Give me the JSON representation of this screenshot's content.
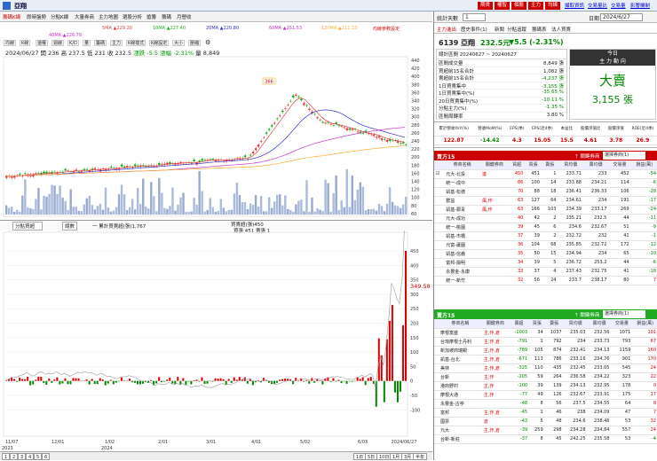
{
  "window": {
    "title": "亞翔",
    "buttons": [
      "期貨",
      "權智",
      "個股",
      "主力",
      "均線"
    ],
    "links": [
      "擷取資訊",
      "交易量比",
      "交易量",
      "影響機制"
    ]
  },
  "top_tabs": [
    "籌碼K線",
    "即時盤勢",
    "分點K線",
    "大量券商",
    "主力地圖",
    "選股分析",
    "搶籌",
    "籌碼",
    "月營收"
  ],
  "ma_legend": [
    {
      "label": "5MA ▲229.20",
      "color": "#d44"
    },
    {
      "label": "10MA ▲227.40",
      "color": "#2a2"
    },
    {
      "label": "20MA ▲220.80",
      "color": "#33c"
    },
    {
      "label": "60MA ▲251.53",
      "color": "#c3c"
    },
    {
      "label": "120MA ▲211.33",
      "color": "#fa3"
    },
    {
      "label": "40MA ▲226.78",
      "color": "#c3c"
    }
  ],
  "right_note": "均線參數設定",
  "chart_toolbar": [
    "均線",
    "K線",
    "還權",
    "週線",
    "K/D",
    "量",
    "籌碼",
    "主力",
    "K線樣式",
    "K線設定",
    "大小",
    "壓縮"
  ],
  "info_line": {
    "date": "2024/06/27",
    "open": "開 236",
    "high": "高 237.5",
    "low": "低 231",
    "close": "收 232.5",
    "change": "漲跌 -5.5",
    "pct": "漲幅 -2.31%",
    "vol": "量 8,849"
  },
  "price_axis": [
    "440",
    "420",
    "400",
    "380",
    "360",
    "340",
    "320",
    "300",
    "280",
    "260",
    "240",
    "220",
    "200",
    "180",
    "160",
    "140",
    "120",
    "100",
    "80",
    "60"
  ],
  "peak_label": "366",
  "lower_header": {
    "select": "分點買超",
    "btn": "總數",
    "legend1": "一 累計買賣超(張)1,767",
    "legend2": "買賣超(張)450",
    "legend3": "買張 451  賣張 1"
  },
  "lower_axis": [
    "450",
    "400",
    "350",
    "300",
    "250",
    "200",
    "150",
    "100",
    "50",
    "0",
    "-50",
    "-100"
  ],
  "lower_label": "349.58",
  "date_axis": [
    "11/07",
    "12/01",
    "1/02",
    "2/01",
    "3/01",
    "4/01",
    "5/02",
    "6/03",
    "2024/06/27"
  ],
  "date_axis_years": [
    "2023",
    "2024"
  ],
  "bottom_pages": [
    "1",
    "2",
    "3",
    "4",
    "5",
    "6"
  ],
  "bottom_periods": [
    "1日",
    "5日",
    "10日",
    "1月",
    "3月",
    "半年"
  ],
  "right": {
    "days_label": "統計天數",
    "days_value": "1",
    "date_label": "日期",
    "date_value": "2024/6/27",
    "tabs": [
      "主力進出",
      "歷史事件(1)",
      "新聞",
      "分點追蹤",
      "籌碼表",
      "法人買賣"
    ],
    "stock": "6139 亞翔",
    "price": "232.5元",
    "chg": "▼5.5 (-2.31%)",
    "summary_title": "總計區間  20240627 ~ 20240627",
    "summary": [
      [
        "區間成交量",
        "8,849 張"
      ],
      [
        "買超前15名合計",
        "1,082 張"
      ],
      [
        "賣超前15名合計",
        "-4,237 張"
      ],
      [
        "1日買賣集中",
        "-3,155 張"
      ],
      [
        "1日買賣集中(%)",
        "-35.65 %"
      ],
      [
        "20日買賣集中(%)",
        "-10.11 %"
      ],
      [
        "分點主力(%)",
        "-1.35 %"
      ],
      [
        "區間周轉率",
        "3.80 %"
      ]
    ],
    "today_label": "今日",
    "today_sub": "主 力 動 向",
    "today_big": "大賣",
    "today_val": "3,155 張",
    "fin_headers": [
      "累計營收YoY(%)",
      "營收MoM(%)",
      "EPS(季)",
      "EPS(近4季)",
      "本益比",
      "股價淨值比",
      "股價淨值",
      "ROE(近4季)"
    ],
    "fin_values": [
      "122.87",
      "-14.42",
      "4.3",
      "15.05",
      "15.5",
      "4.61",
      "3.78",
      "26.9"
    ],
    "buy_title": "買方15",
    "buy_btn": "↑ 關鍵券商",
    "buy_sel": "選擇券商(1)",
    "buy_headers": [
      "",
      "券商名稱",
      "關鍵券商",
      "買超",
      "買張",
      "賣張",
      "買均價",
      "賣均價",
      "交易量",
      "損益(萬)"
    ],
    "buy_rows": [
      [
        "☑",
        "元大-北投",
        "進",
        "450",
        "451",
        "1",
        "233.71",
        "233",
        "452",
        "-54"
      ],
      [
        "",
        "統一-成中",
        "",
        "86",
        "100",
        "14",
        "233.88",
        "234.21",
        "114",
        "-6"
      ],
      [
        "",
        "凱基-松德",
        "",
        "70",
        "88",
        "18",
        "236.41",
        "236.33",
        "106",
        "-28"
      ],
      [
        "",
        "群益",
        "風,作",
        "63",
        "127",
        "64",
        "234.61",
        "234",
        "191",
        "-17"
      ],
      [
        "",
        "凱基-鄭青",
        "風,作",
        "63",
        "166",
        "103",
        "234.39",
        "233.17",
        "269",
        "-24"
      ],
      [
        "",
        "元大-成功",
        "",
        "40",
        "42",
        "2",
        "235.21",
        "232.5",
        "44",
        "-11"
      ],
      [
        "",
        "統一-桃園",
        "",
        "39",
        "45",
        "6",
        "234.6",
        "232.67",
        "51",
        "-9"
      ],
      [
        "",
        "凱基-市橋",
        "",
        "37",
        "39",
        "2",
        "232.72",
        "232",
        "41",
        "-1"
      ],
      [
        "",
        "元富-蘆園",
        "",
        "36",
        "104",
        "68",
        "235.85",
        "232.72",
        "172",
        "-12"
      ],
      [
        "",
        "凱基-信義",
        "",
        "35",
        "50",
        "15",
        "234.94",
        "234",
        "65",
        "-10"
      ],
      [
        "",
        "富邦-陽明",
        "",
        "34",
        "39",
        "5",
        "236.72",
        "253.2",
        "44",
        "-6"
      ],
      [
        "",
        "永豐金-永康",
        "",
        "33",
        "37",
        "4",
        "237.43",
        "232.75",
        "41",
        "-18"
      ],
      [
        "",
        "統一-新竹",
        "",
        "32",
        "56",
        "24",
        "233.7",
        "238.17",
        "80",
        "7"
      ]
    ],
    "sell_title": "賣方15",
    "sell_btn": "↑ 關鍵券商",
    "sell_sel": "選擇券商(1)",
    "sell_headers": [
      "",
      "券商名稱",
      "關鍵券商",
      "賣超",
      "買張",
      "賣張",
      "買均價",
      "賣均價",
      "交易量",
      "損益(萬)"
    ],
    "sell_rows": [
      [
        "",
        "摩根富盛",
        "主,作,倉",
        "-1003",
        "34",
        "1037",
        "235.03",
        "232.56",
        "1071",
        "101"
      ],
      [
        "",
        "台灣摩根士丹利",
        "主,作,倉",
        "-791",
        "1",
        "792",
        "234",
        "233.73",
        "793",
        "67"
      ],
      [
        "",
        "新加坡商瑞銀",
        "主,作,倉",
        "-789",
        "105",
        "874",
        "232.41",
        "234.13",
        "1159",
        "160"
      ],
      [
        "",
        "凱基-台北",
        "主,作,倉",
        "-671",
        "113",
        "786",
        "233.16",
        "234.76",
        "901",
        "170"
      ],
      [
        "",
        "美林",
        "主,作,倉",
        "-325",
        "110",
        "435",
        "232.45",
        "233.05",
        "545",
        "24"
      ],
      [
        "",
        "台新",
        "主,作",
        "-205",
        "59",
        "264",
        "236.58",
        "234.22",
        "323",
        "22"
      ],
      [
        "",
        "港商野村",
        "主,作",
        "-100",
        "39",
        "139",
        "234.13",
        "232.95",
        "178",
        "0"
      ],
      [
        "",
        "摩根大通",
        "主,作",
        "-77",
        "49",
        "126",
        "232.67",
        "233.91",
        "175",
        "17"
      ],
      [
        "",
        "永豐金-古亭",
        "",
        "-48",
        "8",
        "56",
        "237.5",
        "234.55",
        "64",
        "8"
      ],
      [
        "",
        "富邦",
        "主,作,倉",
        "-45",
        "1",
        "46",
        "238",
        "234.09",
        "47",
        "7"
      ],
      [
        "",
        "國票",
        "倉",
        "-43",
        "5",
        "48",
        "234.6",
        "238.46",
        "53",
        "32"
      ],
      [
        "",
        "元大",
        "主,作,倉",
        "-39",
        "259",
        "298",
        "234.28",
        "234.84",
        "557",
        "24"
      ],
      [
        "",
        "台新-新莊",
        "",
        "-37",
        "8",
        "45",
        "242.25",
        "235.58",
        "53",
        "-4"
      ]
    ]
  }
}
